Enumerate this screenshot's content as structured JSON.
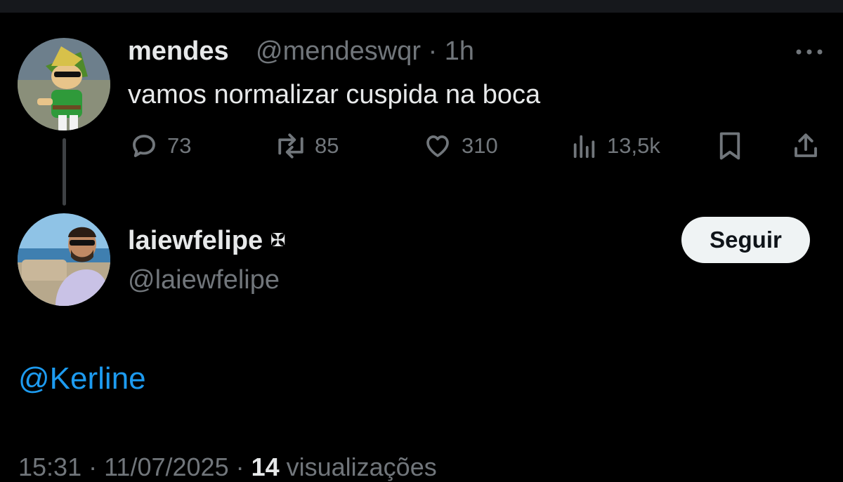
{
  "colors": {
    "background": "#000000",
    "text": "#e7e9ea",
    "secondary": "#71767b",
    "link": "#1d9bf0"
  },
  "original_post": {
    "name": "mendes",
    "handle": "@mendeswqr",
    "separator": "·",
    "time": "1h",
    "text": "vamos normalizar cuspida na boca",
    "actions": {
      "replies": "73",
      "reposts": "85",
      "likes": "310",
      "views": "13,5k"
    }
  },
  "reply_post": {
    "name": "laiewfelipe",
    "name_badge": "✠",
    "handle": "@laiewfelipe",
    "follow_label": "Seguir",
    "mention": "@Kerline",
    "timestamp": "15:31 · 11/07/2025 · ",
    "views_count": "14",
    "views_label": " visualizações"
  }
}
